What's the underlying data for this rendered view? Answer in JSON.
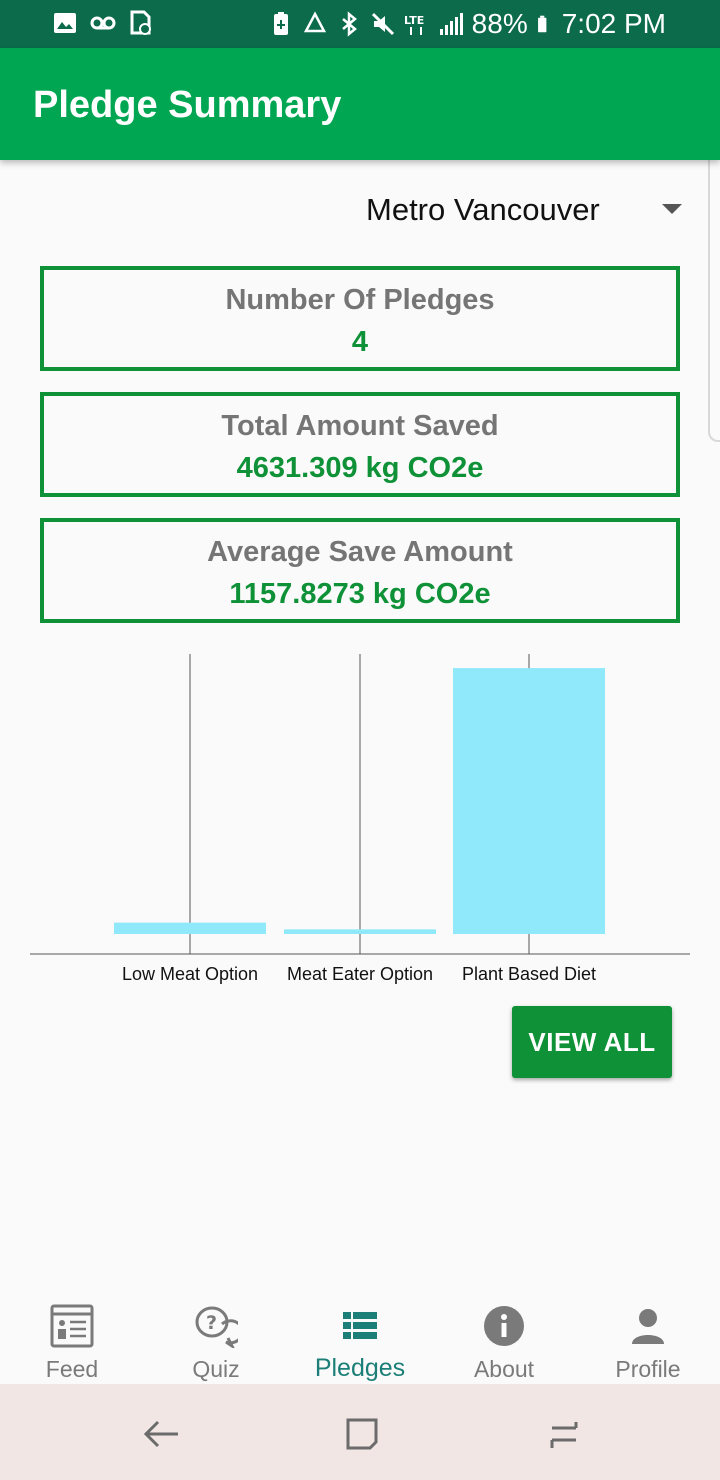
{
  "status_bar": {
    "battery": "88%",
    "time": "7:02 PM",
    "network": "LTE",
    "icons_left": [
      "image-icon",
      "voicemail-icon",
      "sim-clock-icon"
    ],
    "icons_right": [
      "battery-saver-icon",
      "recycle-icon",
      "bluetooth-icon",
      "mute-icon",
      "lte-icon",
      "signal-icon",
      "battery-icon"
    ]
  },
  "app_bar": {
    "title": "Pledge Summary"
  },
  "region_select": {
    "value": "Metro Vancouver"
  },
  "stats": [
    {
      "label": "Number Of Pledges",
      "value": "4"
    },
    {
      "label": "Total Amount Saved",
      "value": "4631.309 kg CO2e"
    },
    {
      "label": "Average Save Amount",
      "value": "1157.8273 kg CO2e"
    }
  ],
  "chart_data": {
    "type": "bar",
    "categories": [
      "Low Meat Option",
      "Meat Eater Option",
      "Plant Based Diet"
    ],
    "values": [
      186.5,
      76.2,
      4368.6
    ],
    "ylim": [
      0,
      4600
    ],
    "grid": true,
    "bar_color": "#8fe9fb"
  },
  "view_all": {
    "label": "VIEW ALL"
  },
  "bottom_nav": {
    "active": "Pledges",
    "items": [
      {
        "label": "Feed",
        "icon": "feed-icon"
      },
      {
        "label": "Quiz",
        "icon": "quiz-icon"
      },
      {
        "label": "Pledges",
        "icon": "pledges-icon"
      },
      {
        "label": "About",
        "icon": "info-icon"
      },
      {
        "label": "Profile",
        "icon": "person-icon"
      }
    ]
  },
  "colors": {
    "primary": "#00a651",
    "accent": "#0e9137",
    "status_bar": "#0b6b4a",
    "active_nav": "#1b7f77"
  }
}
